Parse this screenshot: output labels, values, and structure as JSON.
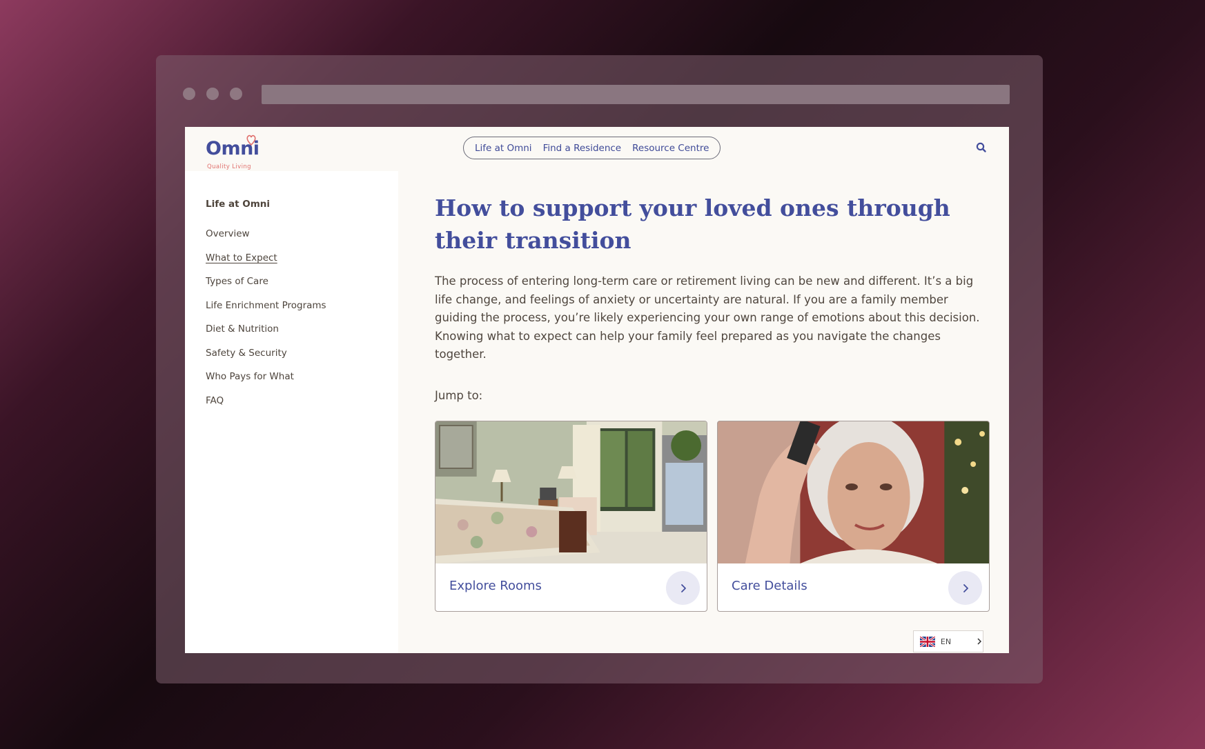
{
  "brand": {
    "name": "Omni",
    "tagline": "Quality Living",
    "heart_color": "#e0706d",
    "primary_color": "#434e9c"
  },
  "nav": {
    "items": [
      "Life at Omni",
      "Find a Residence",
      "Resource Centre"
    ],
    "search_icon": "search-icon"
  },
  "sidebar": {
    "heading": "Life at Omni",
    "items": [
      "Overview",
      "What to Expect",
      "Types of Care",
      "Life Enrichment Programs",
      "Diet & Nutrition",
      "Safety & Security",
      "Who Pays for What",
      "FAQ"
    ],
    "active": "What to Expect"
  },
  "main": {
    "title": "How to support your loved ones through their transition",
    "intro": "The process of entering long-term care or retirement living can be new and different. It’s a big life change, and feelings of anxiety or uncertainty are natural. If you are a family member guiding the process, you’re likely experiencing your own range of emotions about this decision. Knowing what to expect can help your family feel prepared as you navigate the changes together.",
    "jump_label": "Jump to:",
    "cards": [
      {
        "label": "Explore Rooms",
        "image": "bedroom-photo"
      },
      {
        "label": "Care Details",
        "image": "senior-woman-photo"
      }
    ]
  },
  "language": {
    "code": "EN",
    "flag": "uk-flag-icon"
  }
}
